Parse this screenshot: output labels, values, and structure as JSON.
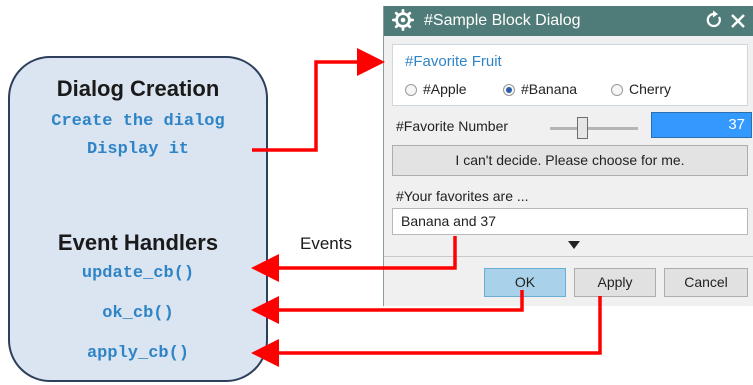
{
  "left_panel": {
    "creation_title": "Dialog Creation",
    "creation_lines": [
      "Create the dialog",
      "Display it"
    ],
    "handlers_title": "Event Handlers",
    "handlers": [
      "update_cb()",
      "ok_cb()",
      "apply_cb()"
    ]
  },
  "events_label": "Events",
  "dialog": {
    "title": "#Sample Block Dialog",
    "fruit_group": {
      "title": "#Favorite Fruit",
      "options": [
        {
          "label": "#Apple",
          "selected": false
        },
        {
          "label": "#Banana",
          "selected": true
        },
        {
          "label": "Cherry",
          "selected": false
        }
      ]
    },
    "number_label": "#Favorite Number",
    "slider_level": 0.37,
    "number_value": "37",
    "decide_button": "I can't decide. Please choose for me.",
    "favorites_label": "#Your favorites are ...",
    "favorites_value": "Banana and 37",
    "buttons": {
      "ok": "OK",
      "apply": "Apply",
      "cancel": "Cancel"
    }
  },
  "colors": {
    "arrow": "#ff0000",
    "titlebar": "#4f7c78",
    "code_text": "#2f84c6",
    "panel_fill": "#dbe5f1",
    "number_highlight": "#3399ff"
  }
}
